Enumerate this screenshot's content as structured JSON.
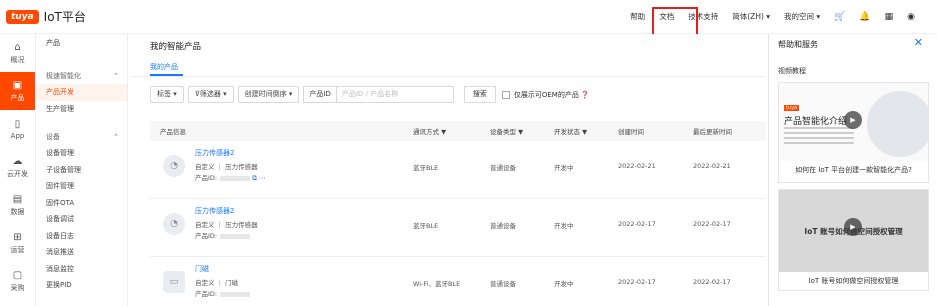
{
  "app": {
    "logo_badge": "tuya",
    "logo_text": "IoT平台"
  },
  "topnav": {
    "help": "帮助",
    "docs": "文档",
    "tech_support": "技术支持",
    "language": "简体(ZH) ▾",
    "space": "我的空间 ▾"
  },
  "sidebar": [
    {
      "label": "概况",
      "icon": "home-icon"
    },
    {
      "label": "产品",
      "icon": "product-icon"
    },
    {
      "label": "App",
      "icon": "mobile-icon"
    },
    {
      "label": "云开发",
      "icon": "cloud-icon"
    },
    {
      "label": "数据",
      "icon": "chart-icon"
    },
    {
      "label": "运营",
      "icon": "operation-icon"
    },
    {
      "label": "采购",
      "icon": "purchase-icon"
    }
  ],
  "submenu": {
    "head": "产品",
    "group1": "极速智能化",
    "group1_items": [
      "产品开发",
      "生产管理"
    ],
    "group2": "设备",
    "group2_items": [
      "设备管理",
      "子设备管理",
      "固件管理",
      "固件OTA",
      "设备调试",
      "设备日志",
      "消息推送",
      "消息监控",
      "更换PID"
    ]
  },
  "main": {
    "title": "我的智能产品",
    "tab": "我的产品",
    "filters": {
      "tags": "标签 ▾",
      "filter": "筛选器 ▾",
      "sort": "创建时间倒序 ▾",
      "pid_label": "产品ID",
      "pid_placeholder": "产品ID / 产品名称",
      "search": "搜索",
      "oem": "仅展示可OEM的产品"
    },
    "columns": [
      "产品信息",
      "通讯方式 ▼",
      "设备类型 ▼",
      "开发状态 ▼",
      "创建时间",
      "最后更新时间"
    ],
    "rows": [
      {
        "name": "压力传感器2",
        "meta": "自定义 ｜ 压力传感器",
        "pid_label": "产品ID:",
        "comm": "蓝牙BLE",
        "type": "普通设备",
        "status": "开发中",
        "created": "2022-02-21",
        "updated": "2022-02-21"
      },
      {
        "name": "压力传感器2",
        "meta": "自定义 ｜ 压力传感器",
        "pid_label": "产品ID:",
        "comm": "蓝牙BLE",
        "type": "普通设备",
        "status": "开发中",
        "created": "2022-02-17",
        "updated": "2022-02-17"
      },
      {
        "name": "门磁",
        "meta": "自定义 ｜ 门磁",
        "pid_label": "产品ID:",
        "comm": "Wi-Fi、蓝牙BLE",
        "type": "普通设备",
        "status": "开发中",
        "created": "2022-02-17",
        "updated": "2022-02-17"
      }
    ]
  },
  "rpanel": {
    "title": "帮助和服务",
    "close": "✕",
    "section": "视频教程",
    "card1": {
      "tag": "tuya",
      "big": "产品智能化介绍",
      "caption": "如何在 IoT 平台创建一款智能化产品?"
    },
    "card2": {
      "thumb_text": "IoT 账号如何做空间授权管理",
      "caption": "IoT 账号如何做空间授权管理"
    }
  },
  "colors": {
    "brand": "#ff4800",
    "link": "#1677ff",
    "highlight_box": "#e02020"
  }
}
